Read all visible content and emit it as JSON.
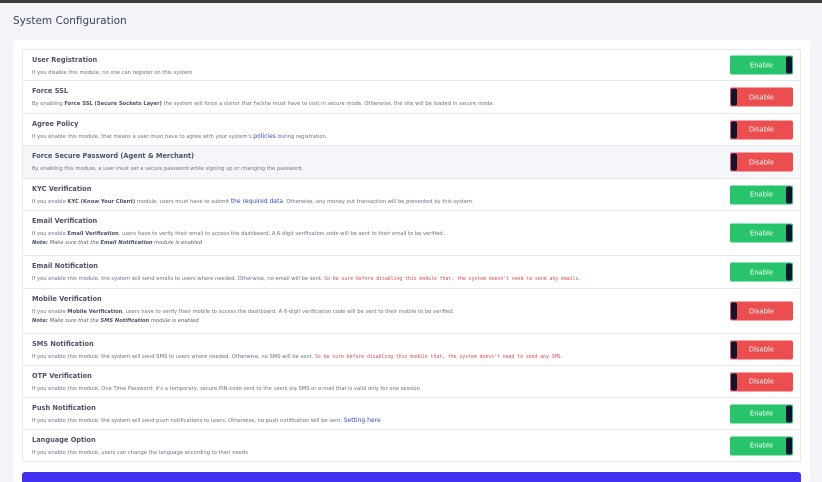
{
  "page": {
    "title": "System Configuration"
  },
  "colors": {
    "enable": "#27c46b",
    "disable": "#ec4d4f",
    "knob": "#0d1530",
    "link": "#2f4ec8",
    "warning": "#e0434c",
    "primary": "#4331f2"
  },
  "settings": [
    {
      "title": "User Registration",
      "desc": [
        {
          "t": "If you disable this module, no one can register on this system"
        }
      ],
      "button": "Enable",
      "state": "on"
    },
    {
      "title": "Force SSL",
      "desc": [
        {
          "t": "By enabling "
        },
        {
          "t": "Force SSL (Secure Sockets Layer)",
          "s": "b"
        },
        {
          "t": " the system will force a visitor that he/she must have to visit in secure mode. Otherwise, the site will be loaded in secure mode."
        }
      ],
      "button": "Disable",
      "state": "off"
    },
    {
      "title": "Agree Policy",
      "desc": [
        {
          "t": "If you enable this module, that means a user must have to agree with your system's "
        },
        {
          "t": "policies",
          "s": "link"
        },
        {
          "t": " during registration."
        }
      ],
      "button": "Disable",
      "state": "off"
    },
    {
      "title": "Force Secure Password (Agent & Merchant)",
      "desc": [
        {
          "t": "By enabling this module, a user must set a secure password while signing up or changing the password."
        }
      ],
      "button": "Disable",
      "state": "off",
      "shaded": true
    },
    {
      "title": "KYC Verification",
      "desc": [
        {
          "t": "If you enable "
        },
        {
          "t": "KYC (Know Your Client)",
          "s": "b"
        },
        {
          "t": " module, users must have to submit "
        },
        {
          "t": "the required data",
          "s": "link"
        },
        {
          "t": ". Otherwise, any money out transaction will be prevented by this system."
        }
      ],
      "button": "Enable",
      "state": "on"
    },
    {
      "title": "Email Verification",
      "desc": [
        {
          "t": "If you enable "
        },
        {
          "t": "Email Verification",
          "s": "b"
        },
        {
          "t": ", users have to verify their email to access the dashboard. A 6-digit verification code will be sent to their email to be verified."
        }
      ],
      "note": [
        {
          "t": "Note:",
          "s": "b"
        },
        {
          "t": " Make sure that the "
        },
        {
          "t": "Email Notification",
          "s": "b"
        },
        {
          "t": " module is enabled"
        }
      ],
      "button": "Enable",
      "state": "on"
    },
    {
      "title": "Email Notification",
      "desc": [
        {
          "t": "If you enable this module, the system will send emails to users where needed. Otherwise, no email will be sent. "
        },
        {
          "t": "So be sure before disabling this module that, the system doesn't need to send any emails.",
          "s": "warn"
        }
      ],
      "button": "Enable",
      "state": "on"
    },
    {
      "title": "Mobile Verification",
      "desc": [
        {
          "t": "If you enable "
        },
        {
          "t": "Mobile Verification",
          "s": "b"
        },
        {
          "t": ", users have to verify their mobile to access the dashboard. A 6-digit verification code will be sent to their mobile to be verified."
        }
      ],
      "note": [
        {
          "t": "Note:",
          "s": "b"
        },
        {
          "t": " Make sure that the "
        },
        {
          "t": "SMS Notification",
          "s": "b"
        },
        {
          "t": " module is enabled"
        }
      ],
      "button": "Disable",
      "state": "off"
    },
    {
      "title": "SMS Notification",
      "desc": [
        {
          "t": "If you enable this module, the system will send SMS to users where needed. Otherwise, no SMS will be sent. "
        },
        {
          "t": "So be sure before disabling this module that, the system doesn't need to send any SMS.",
          "s": "warn"
        }
      ],
      "button": "Disable",
      "state": "off"
    },
    {
      "title": "OTP Verification",
      "desc": [
        {
          "t": "If you enable this module, One Time Password: it's a temporary, secure PIN-code sent to the users via SMS or e-mail that is valid only for one session"
        }
      ],
      "button": "Disable",
      "state": "off"
    },
    {
      "title": "Push Notification",
      "desc": [
        {
          "t": "If you enable this module, the system will send push notifications to users. Otherwise, no push notification will be sent. "
        },
        {
          "t": "Setting here",
          "s": "link"
        }
      ],
      "button": "Enable",
      "state": "on"
    },
    {
      "title": "Language Option",
      "desc": [
        {
          "t": "If you enable this module, users can change the language according to their needs"
        }
      ],
      "button": "Enable",
      "state": "on"
    }
  ]
}
